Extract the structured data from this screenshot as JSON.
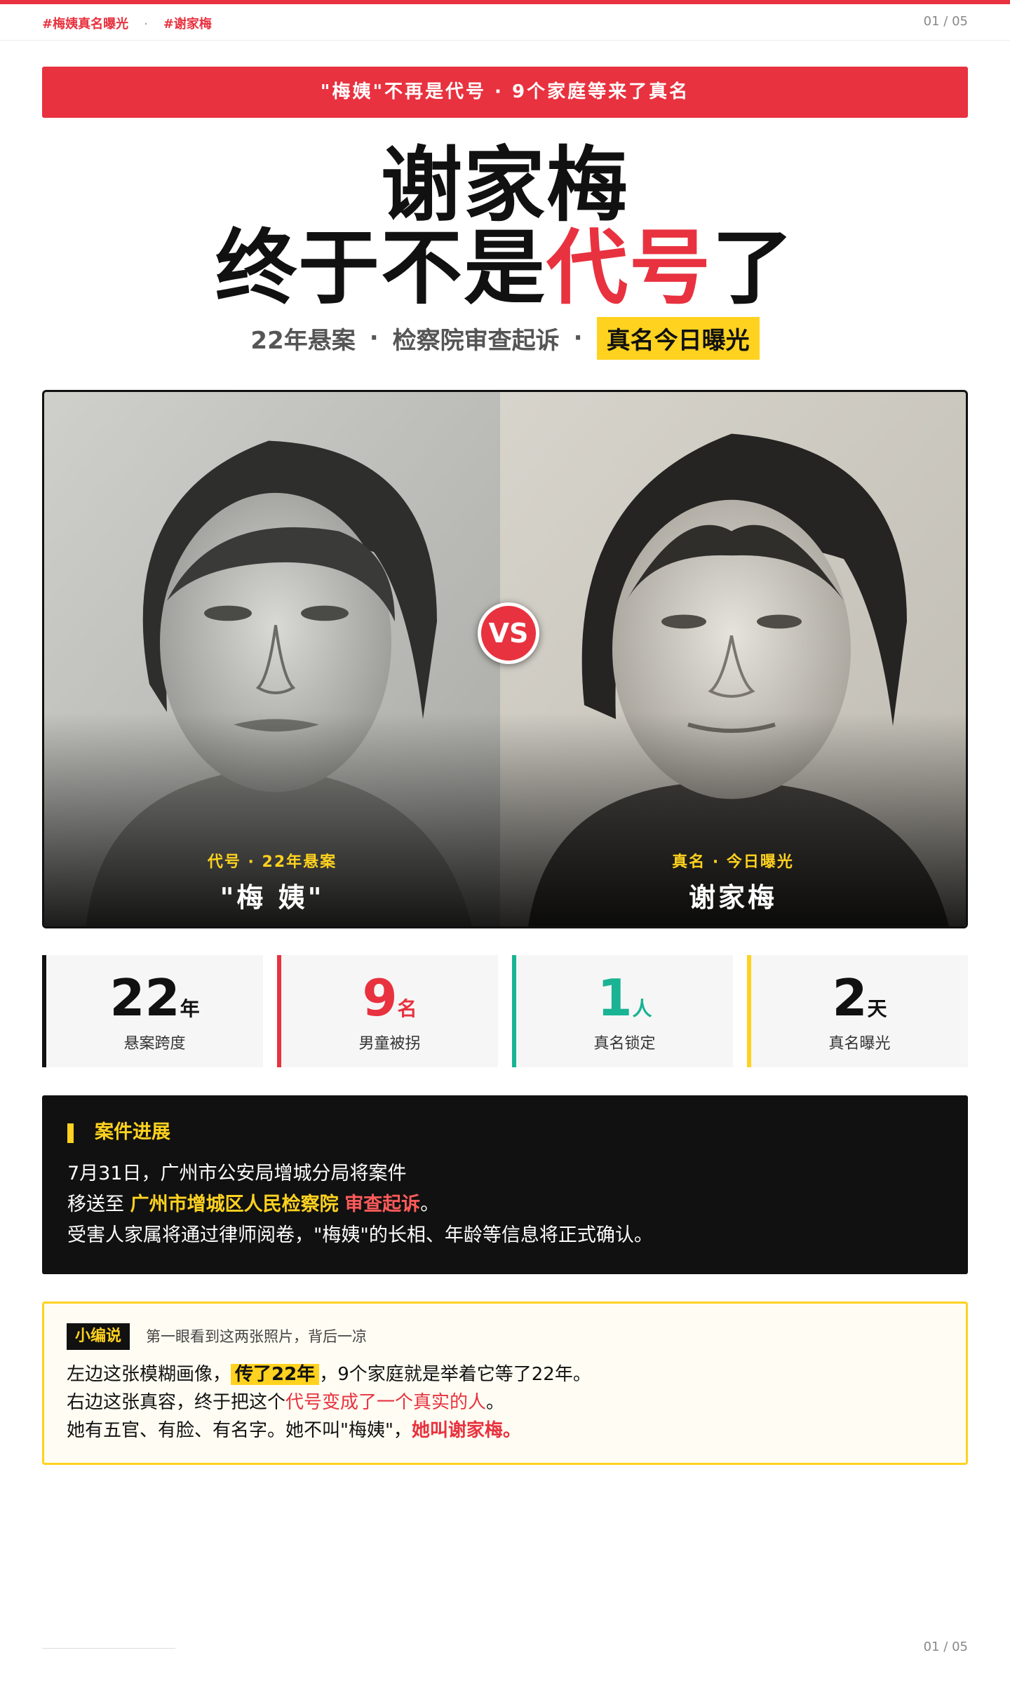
{
  "header": {
    "hashtags": [
      "#梅姨真名曝光",
      "#谢家梅"
    ],
    "separator": "·",
    "page_indicator": "01 / 05"
  },
  "banner": {
    "text": "\"梅姨\"不再是代号 · 9个家庭等来了真名"
  },
  "headline": {
    "line1": "谢家梅",
    "line2_prefix": "终于不是",
    "line2_accent": "代号",
    "line2_suffix": "了"
  },
  "subline": {
    "part1": "22年悬案",
    "part2": "检察院审查起诉",
    "highlight": "真名今日曝光",
    "separator": "·"
  },
  "comparison": {
    "left": {
      "tag": "代号 · 22年悬案",
      "name": "\"梅 姨\""
    },
    "vs_label": "VS",
    "right": {
      "tag": "真名 · 今日曝光",
      "name": "谢家梅"
    }
  },
  "stats": [
    {
      "number": "22",
      "unit": "年",
      "label": "悬案跨度",
      "color": "#111111"
    },
    {
      "number": "9",
      "unit": "名",
      "label": "男童被拐",
      "color": "#e8323f"
    },
    {
      "number": "1",
      "unit": "人",
      "label": "真名锁定",
      "color": "#1ab394"
    },
    {
      "number": "2",
      "unit": "天",
      "label": "真名曝光",
      "color": "#ffd21f"
    }
  ],
  "case_progress": {
    "title": "案件进展",
    "line1": "7月31日，广州市公安局增城分局将案件",
    "line2_prefix": "移送至",
    "line2_org": "广州市增城区人民检察院",
    "line2_action": "审查起诉",
    "line2_end": "。",
    "line3": "受害人家属将通过律师阅卷，\"梅姨\"的长相、年龄等信息将正式确认。"
  },
  "editor_note": {
    "tag": "小编说",
    "hint": "第一眼看到这两张照片，背后一凉",
    "line1_prefix": "左边这张模糊画像，",
    "line1_highlight": "传了22年",
    "line1_suffix": "，9个家庭就是举着它等了22年。",
    "line2_prefix": "右边这张真容，终于把这个",
    "line2_red": "代号变成了一个真实的人",
    "line2_suffix": "。",
    "line3_prefix": "她有五官、有脸、有名字。她不叫\"梅姨\"，",
    "line3_red": "她叫谢家梅。"
  },
  "footer": {
    "page_indicator": "01 / 05"
  },
  "colors": {
    "accent_red": "#e8323f",
    "accent_yellow": "#ffd21f",
    "accent_green": "#1ab394",
    "dark": "#111111"
  }
}
